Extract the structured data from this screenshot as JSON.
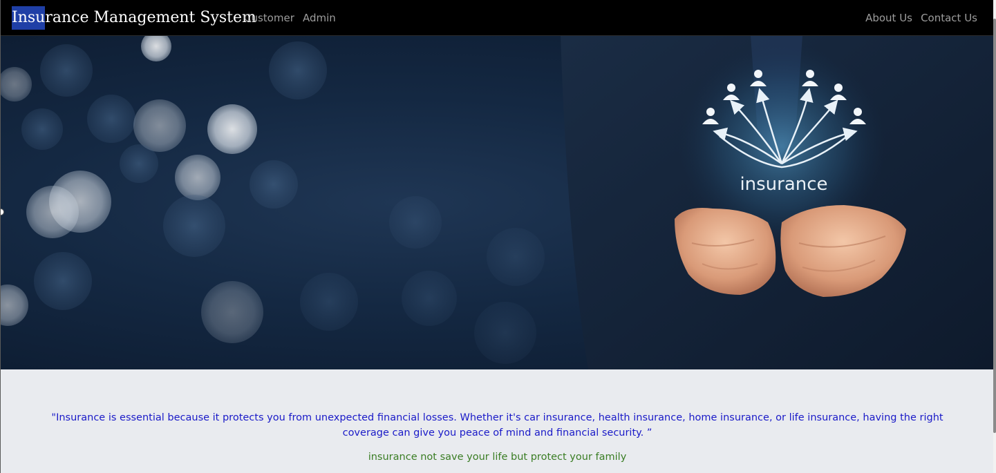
{
  "navbar": {
    "brand_selected": "Insu",
    "brand_rest": "rance Management System",
    "links_left": [
      "Customer",
      "Admin"
    ],
    "links_right": [
      "About Us",
      "Contact Us"
    ]
  },
  "hero": {
    "banner_word": "insurance",
    "image_description_icon": "insurance-hands-network-image"
  },
  "content": {
    "quote": "\"Insurance is essential because it protects you from unexpected financial losses. Whether it's car insurance, health insurance, home insurance, or life insurance, having the right coverage can give you peace of mind and financial security. ”",
    "tagline": "insurance not save your life but protect your family"
  },
  "colors": {
    "navbar_bg": "#000000",
    "nav_link": "#9d9d9d",
    "brand_selection": "#1f3fa6",
    "quote_text": "#1a1ac8",
    "tagline_text": "#3a7d24",
    "content_bg": "#e9ebef"
  }
}
